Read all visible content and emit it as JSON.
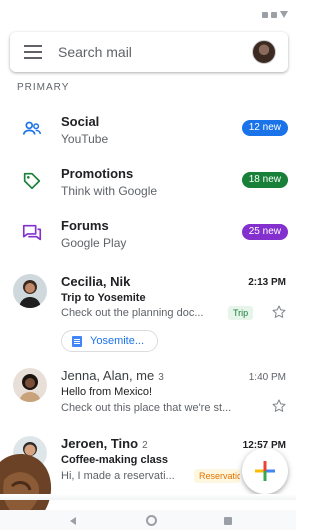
{
  "colors": {
    "social": "#1a73e8",
    "promotions": "#188038",
    "forums": "#8430ce",
    "trip_label_bg": "#e6f4ea",
    "trip_label_fg": "#188038",
    "reservation_label_bg": "#fef7e0",
    "reservation_label_fg": "#e37400"
  },
  "search": {
    "placeholder": "Search mail"
  },
  "section": {
    "label": "PRIMARY"
  },
  "categories": [
    {
      "title": "Social",
      "subtitle": "YouTube",
      "badge": "12 new",
      "icon": "people-icon"
    },
    {
      "title": "Promotions",
      "subtitle": "Think with Google",
      "badge": "18 new",
      "icon": "tag-icon"
    },
    {
      "title": "Forums",
      "subtitle": "Google Play",
      "badge": "25 new",
      "icon": "forum-icon"
    }
  ],
  "emails": [
    {
      "sender": "Cecilia, Nik",
      "count": "",
      "time": "2:13 PM",
      "subject": "Trip to Yosemite",
      "snippet": "Check out the planning doc...",
      "label": "Trip",
      "attachment": "Yosemite...",
      "unread": true
    },
    {
      "sender": "Jenna, Alan, me",
      "count": "3",
      "time": "1:40 PM",
      "subject": "Hello from Mexico!",
      "snippet": "Check out this place that we're st...",
      "label": "",
      "unread": false
    },
    {
      "sender": "Jeroen, Tino",
      "count": "2",
      "time": "12:57 PM",
      "subject": "Coffee-making class",
      "snippet": "Hi, I made a reservati...",
      "label": "Reservatio",
      "unread": true
    }
  ],
  "fab": {
    "icon": "plus-compose-icon"
  }
}
